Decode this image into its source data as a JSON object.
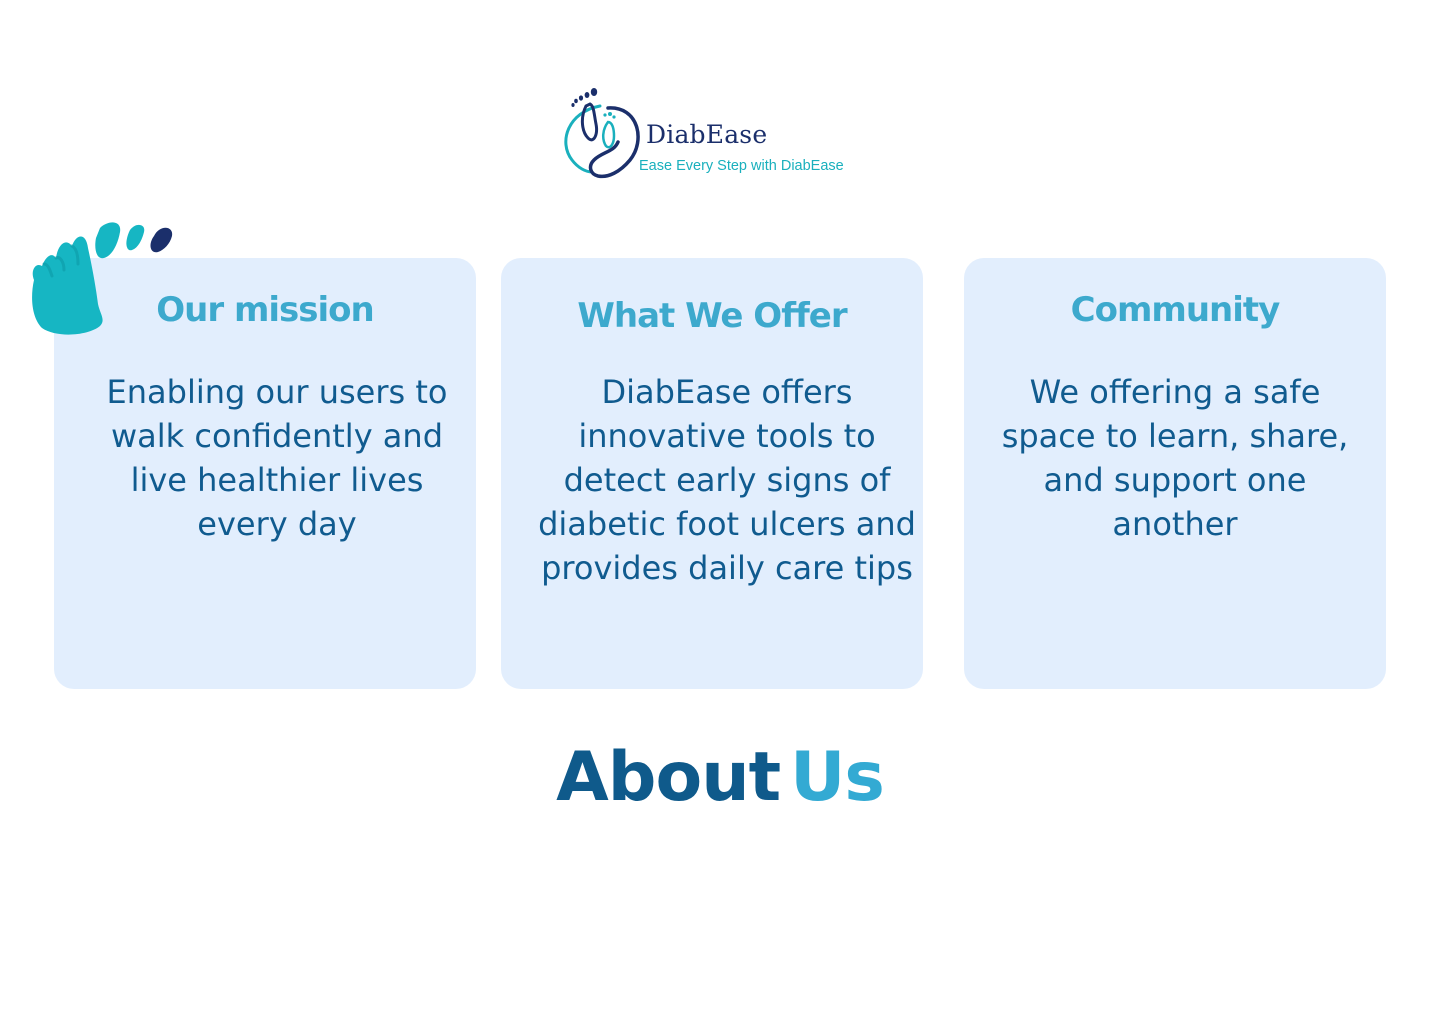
{
  "brand": {
    "name": "DiabEase",
    "tagline": "Ease Every Step with DiabEase",
    "colors": {
      "navy": "#1b2f6b",
      "teal": "#1ab0bd",
      "card_bg": "#e2eefd",
      "title": "#3da9cd",
      "body": "#105b8f"
    }
  },
  "cards": [
    {
      "title": "Our mission",
      "body": "Enabling our users to walk confidently and live healthier lives every day"
    },
    {
      "title": "What We Offer",
      "body": "DiabEase offers innovative tools to detect early signs of diabetic foot ulcers and provides daily care tips"
    },
    {
      "title": "Community",
      "body": "We offering a safe space to learn, share, and support one another"
    }
  ],
  "heading": {
    "part1": "About",
    "part2": "Us"
  },
  "icons": {
    "logo": "footprint-logo-icon",
    "decoration": "footprint-icon"
  }
}
